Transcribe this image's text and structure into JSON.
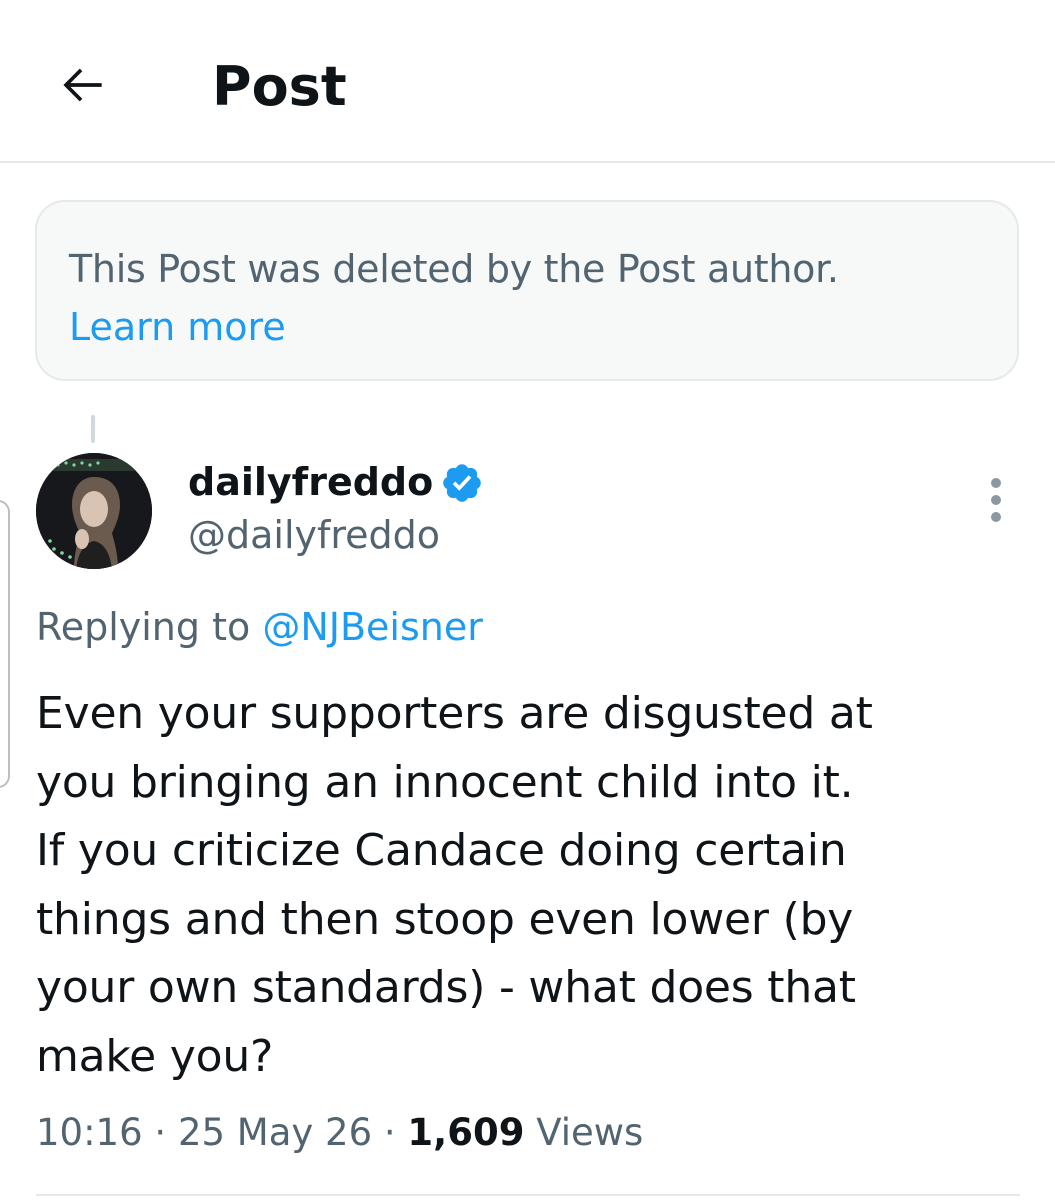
{
  "header": {
    "title": "Post",
    "back_icon": "arrow-left-icon"
  },
  "deleted_notice": {
    "message": "This Post was deleted by the Post author.",
    "link_label": "Learn more"
  },
  "post": {
    "author": {
      "display_name": "dailyfreddo",
      "handle": "@dailyfreddo",
      "verified": true
    },
    "replying_prefix": "Replying to ",
    "replying_to": "@NJBeisner",
    "text": "Even your supporters are disgusted at\nyou bringing an innocent child into it.\nIf you criticize Candace doing certain\nthings and then stoop even lower (by\nyour own standards) - what does that\nmake you?",
    "time": "10:16",
    "date": "25 May 26",
    "views_count": "1,609",
    "views_label": "Views",
    "separator": "·"
  },
  "colors": {
    "accent": "#1d9bf0",
    "secondary_text": "#536471",
    "primary_text": "#0f1419",
    "border": "#e6e9ec",
    "notice_bg": "#f7f9f9"
  }
}
